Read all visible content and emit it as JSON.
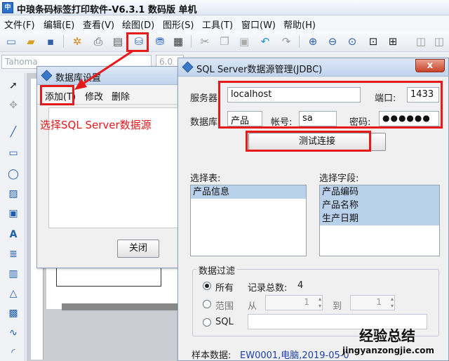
{
  "app": {
    "title": "中琅条码标签打印软件-V6.3.1 数码版 单机",
    "icon": "app-logo-icon"
  },
  "menu": [
    "文件(F)",
    "编辑(E)",
    "查看(V)",
    "绘图(D)",
    "图形(S)",
    "工具(T)",
    "窗口(W)",
    "帮助(H)"
  ],
  "fontbar": {
    "font_name": "Tahoma",
    "font_size": "6.0"
  },
  "db_settings": {
    "title": "数据库设置",
    "toolbar": {
      "add": "添加(T)",
      "modify": "修改",
      "delete": "删除"
    },
    "annotation": "选择SQL Server数据源",
    "close": "关闭"
  },
  "sql_dialog": {
    "title": "SQL Server数据源管理(JDBC)",
    "close_glyph": "x",
    "server_label": "服务器",
    "server_value": "localhost",
    "port_label": "端口:",
    "port_value": "1433",
    "database_label": "数据库",
    "database_value": "产品",
    "account_label": "帐号:",
    "account_value": "sa",
    "password_label": "密码:",
    "password_value": "●●●●●●",
    "test_button": "测试连接",
    "tables_label": "选择表:",
    "tables": [
      "产品信息"
    ],
    "fields_label": "选择字段:",
    "fields": [
      "产品编码",
      "产品名称",
      "生产日期"
    ],
    "filter": {
      "title": "数据过滤",
      "all": "所有",
      "total_label": "记录总数:",
      "total_value": "4",
      "range": "范围",
      "from": "从",
      "from_value": "1",
      "to": "到",
      "to_value": "1",
      "sql": "SQL"
    },
    "sample_label": "样本数据:",
    "sample_value": "EW0001,电脑,2019-05-0"
  },
  "watermark": {
    "brand": "经验总结",
    "url": "jingyanzongjie.com"
  },
  "colors": {
    "annotation_red": "#e6191b",
    "selection_blue": "#b9d1ea",
    "link_blue": "#1a3fb0"
  }
}
